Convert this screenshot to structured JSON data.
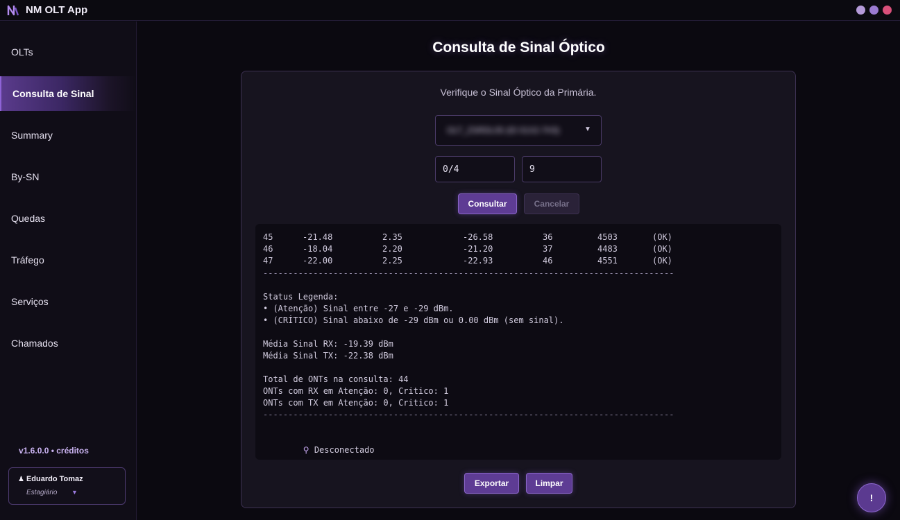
{
  "app": {
    "title": "NM OLT App",
    "brand_color": "#8e63d6"
  },
  "sidebar": {
    "items": [
      {
        "label": "OLTs"
      },
      {
        "label": "Consulta de Sinal",
        "active": true
      },
      {
        "label": "Summary"
      },
      {
        "label": "By-SN"
      },
      {
        "label": "Quedas"
      },
      {
        "label": "Tráfego"
      },
      {
        "label": "Serviços"
      },
      {
        "label": "Chamados"
      }
    ],
    "version": "v1.6.0.0 • créditos",
    "user": {
      "name": "Eduardo Tomaz",
      "role": "Estagiário",
      "icon": "user-icon"
    }
  },
  "main": {
    "title": "Consulta de Sinal Óptico",
    "subtitle": "Verifique o Sinal Óptico da Primária.",
    "olt_select": {
      "value": "OLT_ZSRDL05 (ID 01X2-7H3)",
      "caret": "▼"
    },
    "pon_field": {
      "value": "0/4"
    },
    "ont_field": {
      "value": "9"
    },
    "buttons": {
      "consultar": "Consultar",
      "cancelar": "Cancelar",
      "exportar": "Exportar",
      "limpar": "Limpar"
    },
    "output": {
      "rows": [
        {
          "id": "45",
          "rx": "-21.48",
          "tx": "2.35",
          "olt_rx": "-26.58",
          "temp": "36",
          "dist": "4503",
          "status": "(OK)"
        },
        {
          "id": "46",
          "rx": "-18.04",
          "tx": "2.20",
          "olt_rx": "-21.20",
          "temp": "37",
          "dist": "4483",
          "status": "(OK)"
        },
        {
          "id": "47",
          "rx": "-22.00",
          "tx": "2.25",
          "olt_rx": "-22.93",
          "temp": "46",
          "dist": "4551",
          "status": "(OK)"
        }
      ],
      "divider": "----------------------------------------------------------------------------------",
      "legend_title": "Status Legenda:",
      "legend_attention": "• (Atenção) Sinal entre -27 e -29 dBm.",
      "legend_critical": "• (CRÍTICO) Sinal abaixo de -29 dBm ou 0.00 dBm (sem sinal).",
      "avg_rx": "Média Sinal RX: -19.39 dBm",
      "avg_tx": "Média Sinal TX: -22.38 dBm",
      "total": "Total de ONTs na consulta: 44",
      "rx_summary": "ONTs com RX em Atenção: 0, Critico: 1",
      "tx_summary": "ONTs com TX em Atenção: 0, Critico: 1",
      "connection_icon": "plug-icon",
      "connection_status": "Desconectado"
    }
  },
  "help_button": {
    "label": "!"
  }
}
